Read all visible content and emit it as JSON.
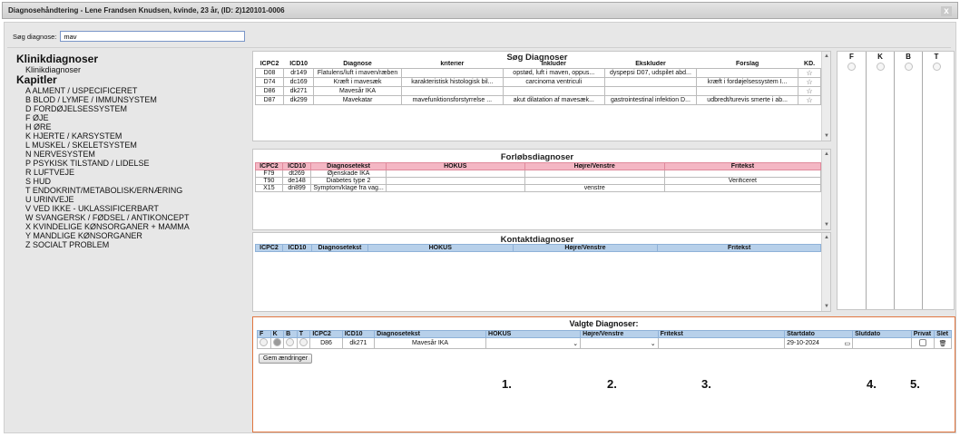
{
  "window": {
    "title": "Diagnosehåndtering - Lene Frandsen Knudsen, kvinde, 23 år, (ID: 2)120101-0006",
    "close_glyph": "x"
  },
  "search": {
    "label": "Søg diagnose:",
    "value": "mav"
  },
  "left": {
    "section1": "Klinikdiagnoser",
    "section1_item": "Klinikdiagnoser",
    "section2": "Kapitler",
    "chapters": [
      "A ALMENT / USPECIFICERET",
      "B BLOD / LYMFE / IMMUNSYSTEM",
      "D FORDØJELSESSYSTEM",
      "F ØJE",
      "H ØRE",
      "K HJERTE / KARSYSTEM",
      "L MUSKEL / SKELETSYSTEM",
      "N NERVESYSTEM",
      "P PSYKISK TILSTAND / LIDELSE",
      "R LUFTVEJE",
      "S HUD",
      "T ENDOKRINT/METABOLISK/ERNÆRING",
      "U URINVEJE",
      "V VED IKKE - UKLASSIFICERBART",
      "W SVANGERSK / FØDSEL / ANTIKONCEPT",
      "X KVINDELIGE KØNSORGANER + MAMMA",
      "Y MANDLIGE KØNSORGANER",
      "Z SOCIALT PROBLEM"
    ]
  },
  "search_panel": {
    "title": "Søg Diagnoser",
    "headers": [
      "ICPC2",
      "ICD10",
      "Diagnose",
      "kriterier",
      "Inkluder",
      "Ekskluder",
      "Forslag",
      "KD."
    ],
    "rows": [
      [
        "D08",
        "dr149",
        "Flatulens/luft i maven/ræben",
        "",
        "opstød, luft i maven, oppus...",
        "dyspepsi D07, udspilet abd...",
        "",
        "☆"
      ],
      [
        "D74",
        "dc169",
        "Kræft i mavesæk",
        "karakteristisk histologisk bil...",
        "carcinoma ventriculi",
        "",
        "kræft i fordøjelsessystem I...",
        "☆"
      ],
      [
        "D86",
        "dk271",
        "Mavesår IKA",
        "",
        "",
        "",
        "",
        "☆"
      ],
      [
        "D87",
        "dk299",
        "Mavekatar",
        "mavefunktionsforstyrrelse ...",
        "akut dilatation af mavesæk...",
        "gastrointestinal infektion D...",
        "udbredt/turevis smerte i ab...",
        "☆"
      ]
    ]
  },
  "course_panel": {
    "title": "Forløbsdiagnoser",
    "headers": [
      "ICPC2",
      "ICD10",
      "Diagnosetekst",
      "HOKUS",
      "Højre/Venstre",
      "Fritekst"
    ],
    "rows": [
      [
        "F79",
        "dt269",
        "Øjenskade IKA",
        "",
        "",
        ""
      ],
      [
        "T90",
        "de148",
        "Diabetes type 2",
        "",
        "",
        "Verificeret"
      ],
      [
        "X15",
        "dn899",
        "Symptom/klage fra vag...",
        "",
        "venstre",
        ""
      ]
    ]
  },
  "contact_panel": {
    "title": "Kontaktdiagnoser",
    "headers": [
      "ICPC2",
      "ICD10",
      "Diagnosetekst",
      "HOKUS",
      "Højre/Venstre",
      "Fritekst"
    ]
  },
  "right_panel": {
    "headers": [
      "F",
      "K",
      "B",
      "T"
    ]
  },
  "selected": {
    "title": "Valgte Diagnoser:",
    "headers": [
      "F",
      "K",
      "B",
      "T",
      "ICPC2",
      "ICD10",
      "Diagnosetekst",
      "HOKUS",
      "Højre/Venstre",
      "Fritekst",
      "Startdato",
      "Slutdato",
      "Privat",
      "Slet"
    ],
    "row": {
      "icpc2": "D86",
      "icd10": "dk271",
      "text": "Mavesår IKA",
      "hokus": "",
      "side": "",
      "fritekst": "",
      "startdato": "29-10-2024",
      "slutdato": ""
    },
    "save_button": "Gem ændringer",
    "markers": [
      "1.",
      "2.",
      "3.",
      "4.",
      "5."
    ]
  },
  "colors": {
    "pink_header": "#f4b7c4",
    "blue_header": "#b7d0ea",
    "orange_border": "#e07640"
  }
}
